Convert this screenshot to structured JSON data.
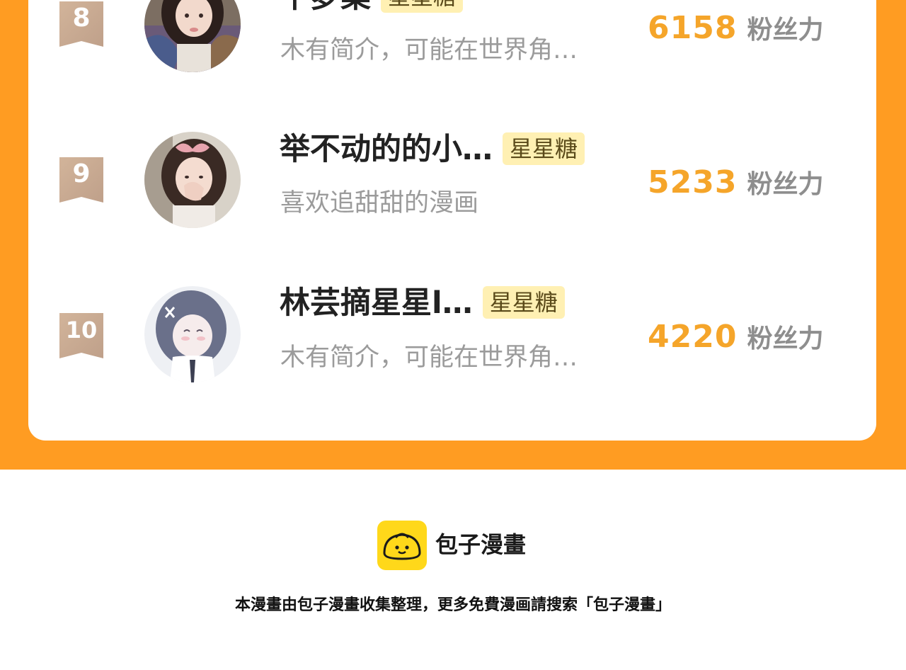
{
  "ranking": {
    "items": [
      {
        "rank": "8",
        "name": "千梦棠",
        "tag": "星星糖",
        "bio": "木有简介，可能在世界角…",
        "score": "6158",
        "score_unit": "粉丝力"
      },
      {
        "rank": "9",
        "name": "举不动的的小…",
        "tag": "星星糖",
        "bio": "喜欢追甜甜的漫画",
        "score": "5233",
        "score_unit": "粉丝力"
      },
      {
        "rank": "10",
        "name": "林芸摘星星l…",
        "tag": "星星糖",
        "bio": "木有简介，可能在世界角…",
        "score": "4220",
        "score_unit": "粉丝力"
      }
    ]
  },
  "brand": {
    "logo_icon": "steamed-bun-icon",
    "name": "包子漫畫"
  },
  "footer": {
    "note": "本漫畫由包子漫畫收集整理，更多免費漫画請搜索「包子漫畫」"
  },
  "colors": {
    "accent_orange": "#FF9C22",
    "score_gold": "#F5A52A",
    "tag_bg": "#FFF0B3",
    "badge_tan": "#C9A98E",
    "brand_yellow": "#FFD81A"
  }
}
